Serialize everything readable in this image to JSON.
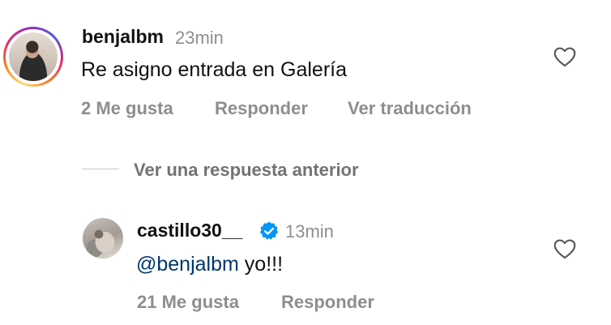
{
  "comments": [
    {
      "username": "benjalbm",
      "time": "23min",
      "text": "Re asigno entrada en Galería",
      "likes": "2 Me gusta",
      "reply_label": "Responder",
      "translate_label": "Ver traducción"
    },
    {
      "username": "castillo30__",
      "verified": true,
      "time": "13min",
      "mention": "@benjalbm",
      "text": " yo!!!",
      "likes": "21 Me gusta",
      "reply_label": "Responder"
    }
  ],
  "view_previous_reply": "Ver una respuesta anterior",
  "colors": {
    "text": "#111111",
    "secondary": "#8e8e8e",
    "mention": "#00376b",
    "verified": "#0095f6",
    "divider": "#c7c7c7"
  },
  "icons": {
    "like": "heart-outline-icon",
    "verified": "verified-badge-icon"
  }
}
